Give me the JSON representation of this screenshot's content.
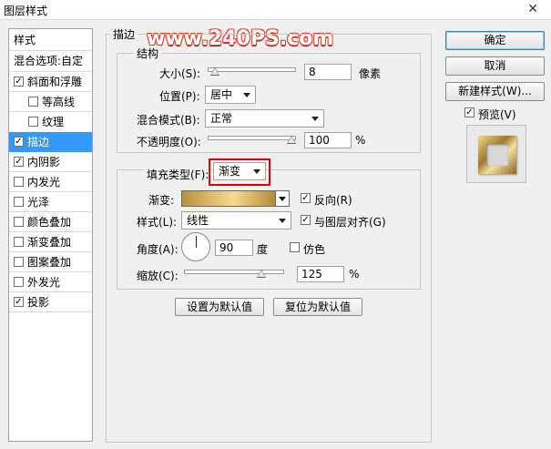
{
  "window": {
    "title": "图层样式"
  },
  "watermark": "www.240PS.com",
  "left_panel": {
    "header": "样式",
    "blend_options": "混合选项:自定",
    "items": [
      {
        "label": "斜面和浮雕",
        "checked": true,
        "indent": false,
        "selected": false
      },
      {
        "label": "等高线",
        "checked": false,
        "indent": true,
        "selected": false
      },
      {
        "label": "纹理",
        "checked": false,
        "indent": true,
        "selected": false
      },
      {
        "label": "描边",
        "checked": true,
        "indent": false,
        "selected": true
      },
      {
        "label": "内阴影",
        "checked": true,
        "indent": false,
        "selected": false
      },
      {
        "label": "内发光",
        "checked": false,
        "indent": false,
        "selected": false
      },
      {
        "label": "光泽",
        "checked": false,
        "indent": false,
        "selected": false
      },
      {
        "label": "颜色叠加",
        "checked": false,
        "indent": false,
        "selected": false
      },
      {
        "label": "渐变叠加",
        "checked": false,
        "indent": false,
        "selected": false
      },
      {
        "label": "图案叠加",
        "checked": false,
        "indent": false,
        "selected": false
      },
      {
        "label": "外发光",
        "checked": false,
        "indent": false,
        "selected": false
      },
      {
        "label": "投影",
        "checked": true,
        "indent": false,
        "selected": false
      }
    ]
  },
  "stroke": {
    "group_title": "描边",
    "structure": {
      "group_title": "结构",
      "size_label": "大小(S):",
      "size_value": "8",
      "size_unit": "像素",
      "size_slider_fraction": 0.03,
      "position_label": "位置(P):",
      "position_value": "居中",
      "blend_label": "混合模式(B):",
      "blend_value": "正常",
      "opacity_label": "不透明度(O):",
      "opacity_value": "100",
      "opacity_unit": "%",
      "opacity_slider_fraction": 1.0
    },
    "fill": {
      "fill_type_label": "填充类型(F):",
      "fill_type_value": "渐变",
      "gradient_label": "渐变:",
      "reverse_label": "反向(R)",
      "reverse_checked": true,
      "style_label": "样式(L):",
      "style_value": "线性",
      "align_label": "与图层对齐(G)",
      "align_checked": true,
      "angle_label": "角度(A):",
      "angle_value": "90",
      "angle_unit": "度",
      "dither_label": "仿色",
      "dither_checked": false,
      "scale_label": "缩放(C):",
      "scale_value": "125",
      "scale_unit": "%",
      "scale_slider_fraction": 0.8
    },
    "set_default_button": "设置为默认值",
    "reset_default_button": "复位为默认值"
  },
  "right": {
    "ok_button": "确定",
    "cancel_button": "取消",
    "new_style_button": "新建样式(W)...",
    "preview_label": "预览(V)",
    "preview_checked": true
  },
  "colors": {
    "selection": "#3399ff",
    "highlight": "#e10000",
    "gradient_start": "#b8913c",
    "gradient_mid": "#f6db8e",
    "gradient_end": "#b5893a"
  }
}
